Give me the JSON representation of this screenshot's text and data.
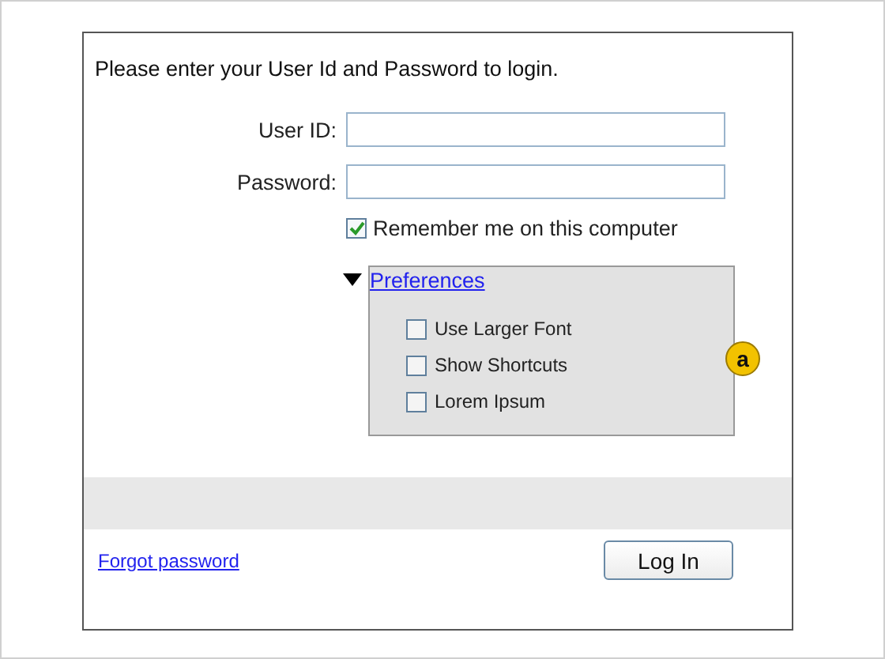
{
  "intro": "Please enter your User Id and Password to login.",
  "fields": [
    {
      "label": "User ID:"
    },
    {
      "label": "Password:"
    }
  ],
  "remember": {
    "label": "Remember me on this computer",
    "checked": true
  },
  "preferences": {
    "title": "Preferences",
    "expanded": true,
    "options": [
      {
        "label": "Use Larger Font",
        "checked": false
      },
      {
        "label": "Show Shortcuts",
        "checked": false
      },
      {
        "label": "Lorem Ipsum",
        "checked": false
      }
    ]
  },
  "annotation": "a",
  "forgot_link": "Forgot password",
  "login_button": "Log In"
}
